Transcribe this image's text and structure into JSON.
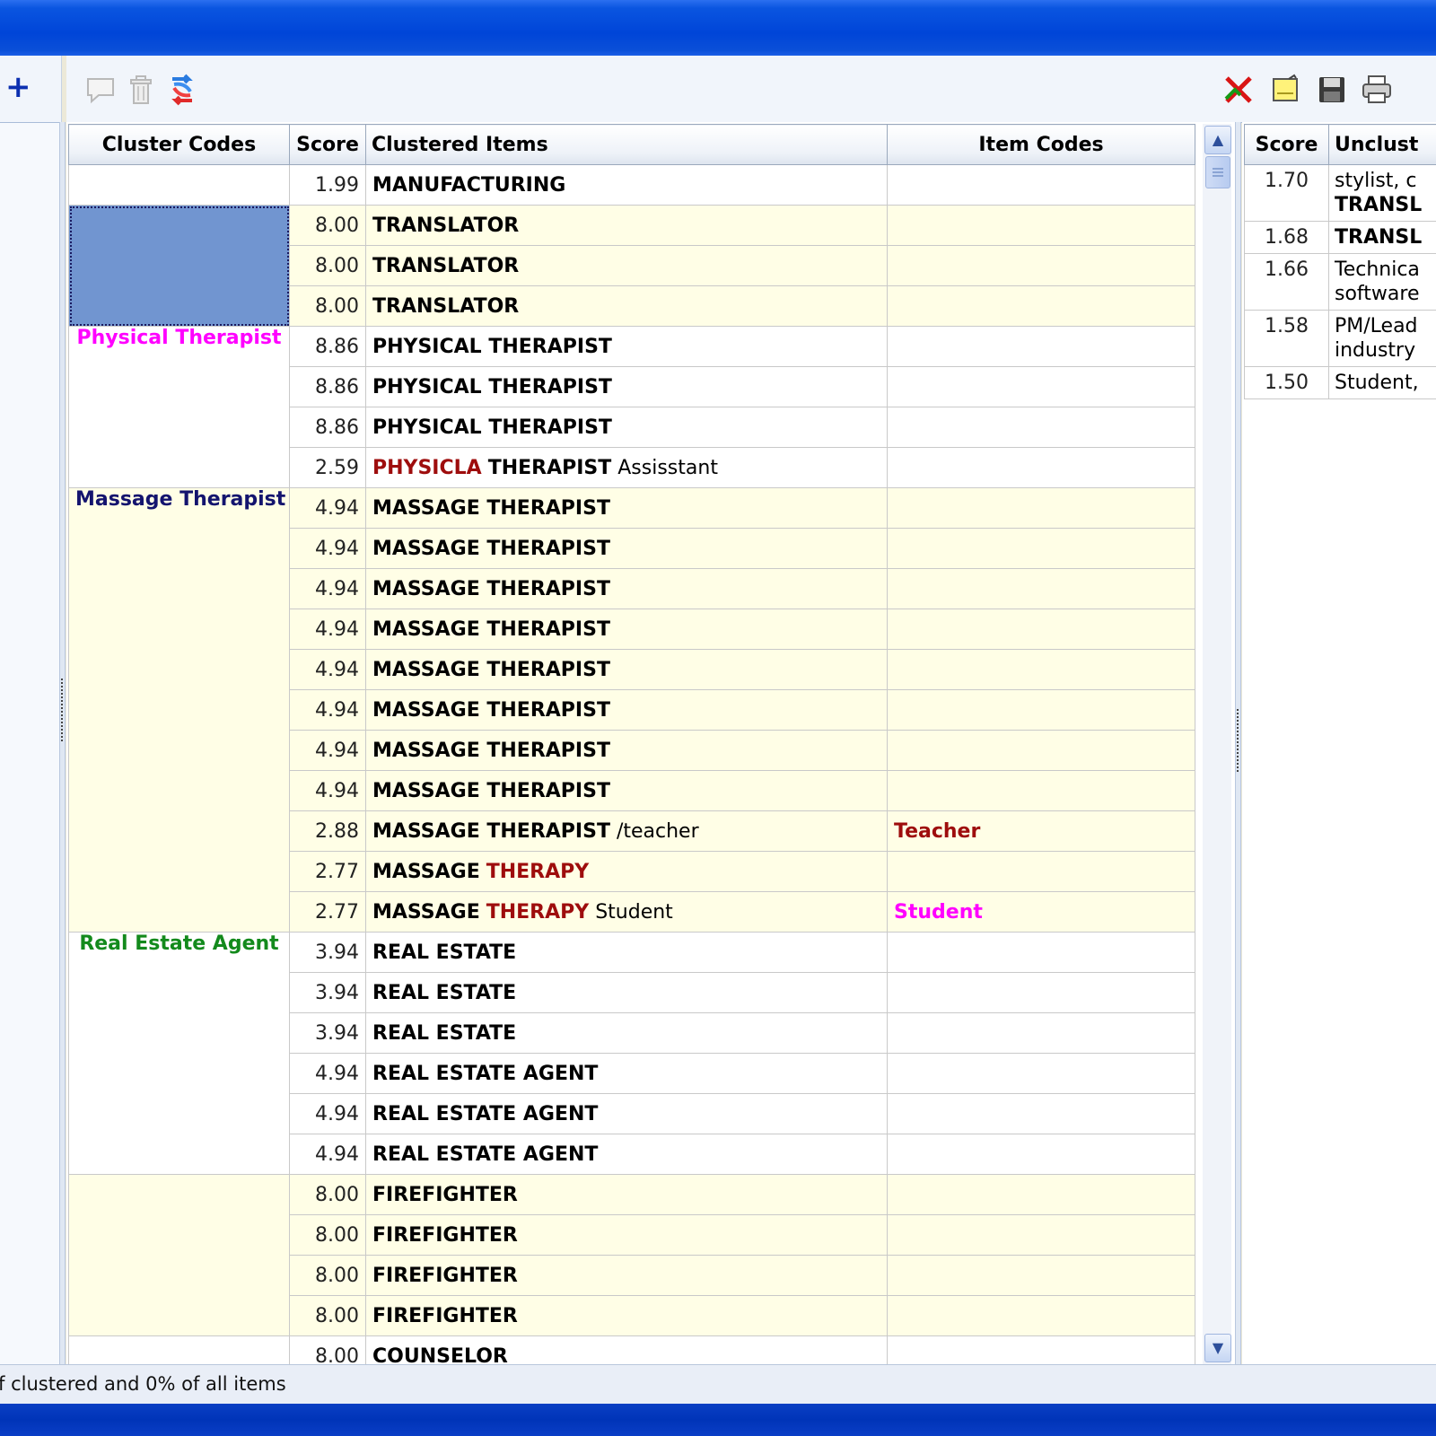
{
  "toolbar": {
    "left_icons": [
      "comment-icon",
      "trash-icon",
      "refresh-icon"
    ],
    "right_icons": [
      "delete-cross-icon",
      "new-note-icon",
      "save-icon",
      "print-icon"
    ]
  },
  "main_table": {
    "headers": {
      "cluster": "Cluster Codes",
      "score": "Score",
      "items": "Clustered Items",
      "codes": "Item Codes"
    },
    "cluster_colors": {
      "physical": "#ff00ff",
      "massage": "#14146e",
      "realestate": "#138a1c"
    },
    "groups": [
      {
        "cluster": "",
        "rows": [
          {
            "score": "1.99",
            "parts": [
              {
                "t": "MANUFACTURING",
                "s": "b"
              }
            ],
            "code": ""
          }
        ]
      },
      {
        "cluster": "",
        "selected": true,
        "shade": true,
        "rows": [
          {
            "score": "8.00",
            "parts": [
              {
                "t": "TRANSLATOR",
                "s": "b"
              }
            ],
            "code": ""
          },
          {
            "score": "8.00",
            "parts": [
              {
                "t": "TRANSLATOR",
                "s": "b"
              }
            ],
            "code": ""
          },
          {
            "score": "8.00",
            "parts": [
              {
                "t": "TRANSLATOR",
                "s": "b"
              }
            ],
            "code": ""
          }
        ]
      },
      {
        "cluster": "Physical Therapist",
        "color": "#ff00ff",
        "rows": [
          {
            "score": "8.86",
            "parts": [
              {
                "t": "PHYSICAL THERAPIST",
                "s": "b"
              }
            ],
            "code": ""
          },
          {
            "score": "8.86",
            "parts": [
              {
                "t": "PHYSICAL THERAPIST",
                "s": "b"
              }
            ],
            "code": ""
          },
          {
            "score": "8.86",
            "parts": [
              {
                "t": "PHYSICAL THERAPIST",
                "s": "b"
              }
            ],
            "code": ""
          },
          {
            "score": "2.59",
            "parts": [
              {
                "t": "PHYSICLA",
                "s": "red"
              },
              {
                "t": " "
              },
              {
                "t": "THERAPIST",
                "s": "b"
              },
              {
                "t": " Assisstant"
              }
            ],
            "code": ""
          }
        ]
      },
      {
        "cluster": "Massage Therapist",
        "color": "#14146e",
        "shade": true,
        "rows": [
          {
            "score": "4.94",
            "parts": [
              {
                "t": "MASSAGE THERAPIST",
                "s": "b"
              }
            ],
            "code": ""
          },
          {
            "score": "4.94",
            "parts": [
              {
                "t": "MASSAGE THERAPIST",
                "s": "b"
              }
            ],
            "code": ""
          },
          {
            "score": "4.94",
            "parts": [
              {
                "t": "MASSAGE THERAPIST",
                "s": "b"
              }
            ],
            "code": ""
          },
          {
            "score": "4.94",
            "parts": [
              {
                "t": "MASSAGE THERAPIST",
                "s": "b"
              }
            ],
            "code": ""
          },
          {
            "score": "4.94",
            "parts": [
              {
                "t": "MASSAGE THERAPIST",
                "s": "b"
              }
            ],
            "code": ""
          },
          {
            "score": "4.94",
            "parts": [
              {
                "t": "MASSAGE THERAPIST",
                "s": "b"
              }
            ],
            "code": ""
          },
          {
            "score": "4.94",
            "parts": [
              {
                "t": "MASSAGE THERAPIST",
                "s": "b"
              }
            ],
            "code": ""
          },
          {
            "score": "4.94",
            "parts": [
              {
                "t": "MASSAGE THERAPIST",
                "s": "b"
              }
            ],
            "code": ""
          },
          {
            "score": "2.88",
            "parts": [
              {
                "t": "MASSAGE THERAPIST",
                "s": "b"
              },
              {
                "t": " /teacher"
              }
            ],
            "code": "Teacher",
            "code_color": "#9e0d0d"
          },
          {
            "score": "2.77",
            "parts": [
              {
                "t": "MASSAGE",
                "s": "b"
              },
              {
                "t": " "
              },
              {
                "t": "THERAPY",
                "s": "red"
              }
            ],
            "code": ""
          },
          {
            "score": "2.77",
            "parts": [
              {
                "t": "MASSAGE",
                "s": "b"
              },
              {
                "t": " "
              },
              {
                "t": "THERAPY",
                "s": "red"
              },
              {
                "t": " Student"
              }
            ],
            "code": "Student",
            "code_color": "#ff00ff"
          }
        ]
      },
      {
        "cluster": "Real Estate Agent",
        "color": "#138a1c",
        "rows": [
          {
            "score": "3.94",
            "parts": [
              {
                "t": "REAL ESTATE",
                "s": "b"
              }
            ],
            "code": ""
          },
          {
            "score": "3.94",
            "parts": [
              {
                "t": "REAL ESTATE",
                "s": "b"
              }
            ],
            "code": ""
          },
          {
            "score": "3.94",
            "parts": [
              {
                "t": "REAL ESTATE",
                "s": "b"
              }
            ],
            "code": ""
          },
          {
            "score": "4.94",
            "parts": [
              {
                "t": "REAL ESTATE AGENT",
                "s": "b"
              }
            ],
            "code": ""
          },
          {
            "score": "4.94",
            "parts": [
              {
                "t": "REAL ESTATE AGENT",
                "s": "b"
              }
            ],
            "code": ""
          },
          {
            "score": "4.94",
            "parts": [
              {
                "t": "REAL ESTATE AGENT",
                "s": "b"
              }
            ],
            "code": ""
          }
        ]
      },
      {
        "cluster": "",
        "shade": true,
        "rows": [
          {
            "score": "8.00",
            "parts": [
              {
                "t": "FIREFIGHTER",
                "s": "b"
              }
            ],
            "code": ""
          },
          {
            "score": "8.00",
            "parts": [
              {
                "t": "FIREFIGHTER",
                "s": "b"
              }
            ],
            "code": ""
          },
          {
            "score": "8.00",
            "parts": [
              {
                "t": "FIREFIGHTER",
                "s": "b"
              }
            ],
            "code": ""
          },
          {
            "score": "8.00",
            "parts": [
              {
                "t": "FIREFIGHTER",
                "s": "b"
              }
            ],
            "code": ""
          }
        ]
      },
      {
        "cluster": "",
        "rows": [
          {
            "score": "8.00",
            "parts": [
              {
                "t": "COUNSELOR",
                "s": "b"
              }
            ],
            "code": ""
          }
        ]
      }
    ]
  },
  "side_table": {
    "headers": {
      "score": "Score",
      "items": "Unclust"
    },
    "rows": [
      {
        "score": "1.70",
        "lines": [
          [
            {
              "t": "stylist, c"
            }
          ],
          [
            {
              "t": "TRANSL",
              "s": "b"
            }
          ]
        ]
      },
      {
        "score": "1.68",
        "lines": [
          [
            {
              "t": "TRANSL",
              "s": "b"
            }
          ]
        ]
      },
      {
        "score": "1.66",
        "lines": [
          [
            {
              "t": "Technica"
            }
          ],
          [
            {
              "t": "software"
            }
          ]
        ]
      },
      {
        "score": "1.58",
        "lines": [
          [
            {
              "t": "PM/Lead"
            }
          ],
          [
            {
              "t": "industry"
            }
          ]
        ]
      },
      {
        "score": "1.50",
        "lines": [
          [
            {
              "t": "Student,"
            }
          ]
        ]
      }
    ]
  },
  "statusbar": {
    "text": "f clustered and 0% of all items"
  }
}
